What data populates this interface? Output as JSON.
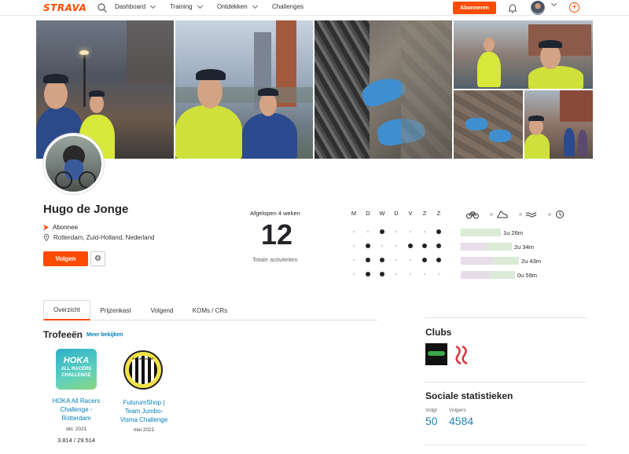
{
  "nav": {
    "logo": "STRAVA",
    "items": [
      "Dashboard",
      "Training",
      "Ontdekken",
      "Challenges"
    ],
    "subscribe_label": "Abonneren"
  },
  "profile": {
    "name": "Hugo de Jonge",
    "subscription": "Abonnee",
    "location": "Rotterdam, Zuid-Holland, Nederland",
    "follow_label": "Volgen"
  },
  "stats": {
    "period_label": "Afgelopen 4 weken",
    "count": "12",
    "count_label": "Totale activiteiten",
    "days": [
      "M",
      "D",
      "W",
      "D",
      "V",
      "Z",
      "Z"
    ],
    "weeks": [
      [
        0,
        0,
        1,
        0,
        0,
        0,
        1
      ],
      [
        0,
        1,
        0,
        0,
        1,
        1,
        1
      ],
      [
        0,
        1,
        1,
        0,
        0,
        1,
        1
      ],
      [
        0,
        1,
        1,
        0,
        0,
        0,
        0
      ]
    ],
    "sports": [
      "bike-icon",
      "run-icon",
      "swim-icon",
      "clock-icon"
    ],
    "durations": [
      {
        "label": "1u 26m",
        "fill": 0.55
      },
      {
        "label": "2u 34m",
        "fill": 0.36
      },
      {
        "label": "2u 43m",
        "fill": 0.45
      },
      {
        "label": "0u 59m",
        "fill": 0.4
      }
    ]
  },
  "tabs": [
    "Overzicht",
    "Prijzenkast",
    "Volgend",
    "KOMs / CRs"
  ],
  "trophies": {
    "title": "Trofeeën",
    "more_label": "Meer bekijken",
    "items": [
      {
        "name_l1": "HOKA All Racers",
        "name_l2": "Challenge -",
        "name_l3": "Rotterdam",
        "date": "okt. 2021",
        "rank": "3.814 / 29.514",
        "badge_text_1": "HOKA",
        "badge_text_2": "ALL RACERS",
        "badge_text_3": "CHALLENGE"
      },
      {
        "name_l1": "FuturumShop |",
        "name_l2": "Team Jumbo-",
        "name_l3": "Visma Challenge",
        "date": "mei 2021",
        "rank": "",
        "badge_text_1": "FUTURUMSHOP"
      }
    ]
  },
  "clubs": {
    "title": "Clubs"
  },
  "social": {
    "title": "Sociale statistieken",
    "following_label": "Volgt",
    "following": "50",
    "followers_label": "Volgers",
    "followers": "4584"
  },
  "colors": {
    "accent": "#fc4c02",
    "link": "#007fb6",
    "bar_green": "#dcebd8",
    "bar_purple": "#e6dde8"
  }
}
